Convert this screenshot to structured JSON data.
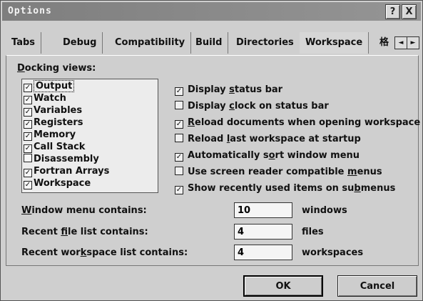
{
  "window": {
    "title": "Options",
    "help_icon": "?",
    "close_icon": "X"
  },
  "tabs": [
    {
      "label": "Tabs"
    },
    {
      "label": "Debug"
    },
    {
      "label": "Compatibility"
    },
    {
      "label": "Build"
    },
    {
      "label": "Directories"
    },
    {
      "label": "Workspace",
      "active": true
    },
    {
      "label": "格"
    }
  ],
  "tab_scroll": {
    "left": "◄",
    "right": "►"
  },
  "docking": {
    "label_prefix": "",
    "label_mnemonic": "D",
    "label_rest": "ocking views:",
    "items": [
      {
        "label": "Output",
        "checked": true,
        "selected": true
      },
      {
        "label": "Watch",
        "checked": true
      },
      {
        "label": "Variables",
        "checked": true
      },
      {
        "label": "Registers",
        "checked": true
      },
      {
        "label": "Memory",
        "checked": true
      },
      {
        "label": "Call Stack",
        "checked": true
      },
      {
        "label": "Disassembly",
        "checked": false
      },
      {
        "label": "Fortran Arrays",
        "checked": true
      },
      {
        "label": "Workspace",
        "checked": true
      }
    ]
  },
  "options": [
    {
      "pre": "Display ",
      "mn": "s",
      "post": "tatus bar",
      "checked": true
    },
    {
      "pre": "Display ",
      "mn": "c",
      "post": "lock on status bar",
      "checked": false
    },
    {
      "pre": "",
      "mn": "R",
      "post": "eload documents when opening workspace",
      "checked": true
    },
    {
      "pre": "Reload ",
      "mn": "l",
      "post": "ast workspace at startup",
      "checked": false
    },
    {
      "pre": "Automatically s",
      "mn": "o",
      "post": "rt window menu",
      "checked": true
    },
    {
      "pre": "Use screen reader compatible ",
      "mn": "m",
      "post": "enus",
      "checked": false
    },
    {
      "pre": "Show recently used items on su",
      "mn": "b",
      "post": "menus",
      "checked": true
    }
  ],
  "fields": [
    {
      "pre": "",
      "mn": "W",
      "post": "indow menu contains:",
      "value": "10",
      "suffix": "windows"
    },
    {
      "pre": "Recent ",
      "mn": "f",
      "post": "ile list contains:",
      "value": "4",
      "suffix": "files"
    },
    {
      "pre": "Recent wor",
      "mn": "k",
      "post": "space list contains:",
      "value": "4",
      "suffix": "workspaces"
    }
  ],
  "buttons": {
    "ok": "OK",
    "cancel": "Cancel"
  },
  "check_glyph": "✓"
}
